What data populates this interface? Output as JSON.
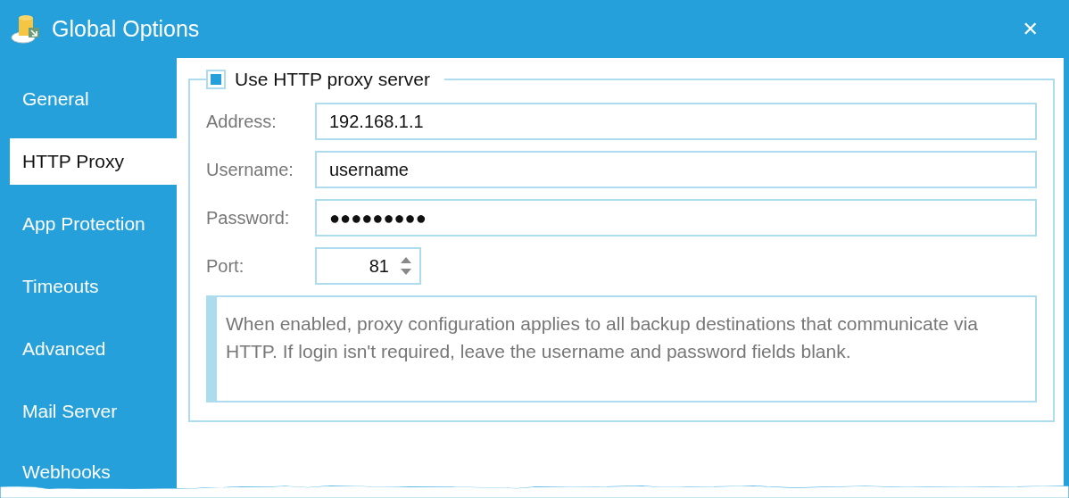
{
  "window": {
    "title": "Global Options",
    "close": "✕"
  },
  "sidebar": {
    "items": [
      {
        "label": "General",
        "selected": false
      },
      {
        "label": "HTTP Proxy",
        "selected": true
      },
      {
        "label": "App Protection",
        "selected": false
      },
      {
        "label": "Timeouts",
        "selected": false
      },
      {
        "label": "Advanced",
        "selected": false
      },
      {
        "label": "Mail Server",
        "selected": false
      },
      {
        "label": "Webhooks",
        "selected": false
      }
    ]
  },
  "proxy": {
    "enable": {
      "label": "Use HTTP proxy server",
      "checked": true
    },
    "fields": [
      {
        "label": "Address:",
        "value": "192.168.1.1"
      },
      {
        "label": "Username:",
        "value": "username"
      },
      {
        "label": "Password:",
        "value": "●●●●●●●●●"
      }
    ],
    "port": {
      "label": "Port:",
      "value": "81"
    },
    "note": "When enabled, proxy configuration applies to all backup destinations that communicate via HTTP. If login isn't required, leave the username and password fields blank."
  }
}
